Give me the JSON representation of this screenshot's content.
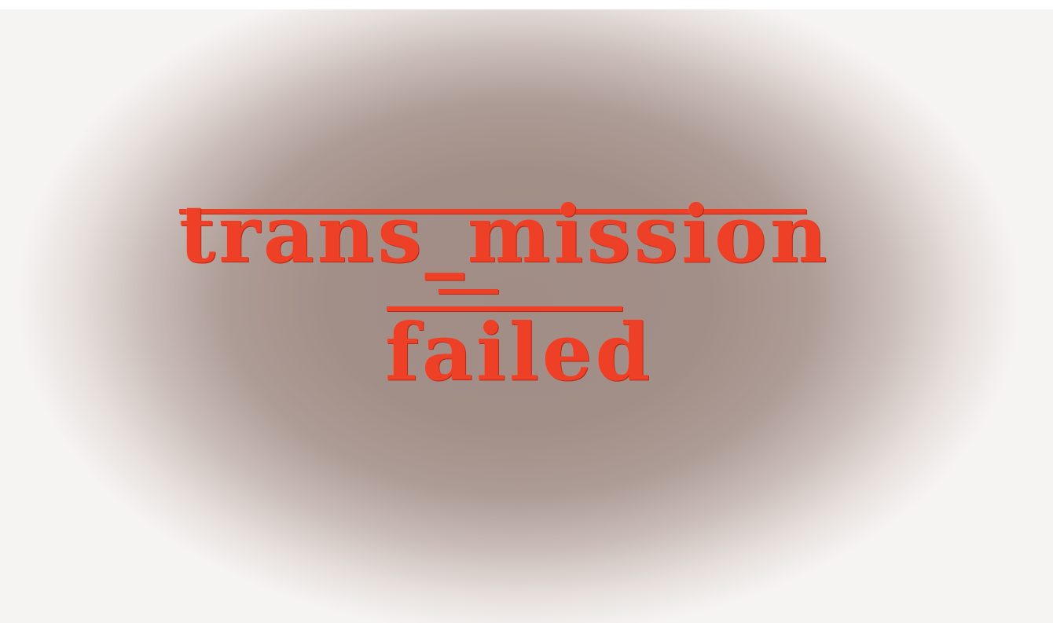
{
  "message": {
    "line_1": "trans_mission",
    "line_2": "failed"
  },
  "colors": {
    "text": "#ee3f27",
    "background_center": "#a18d86",
    "background_edge": "#ffffff"
  }
}
